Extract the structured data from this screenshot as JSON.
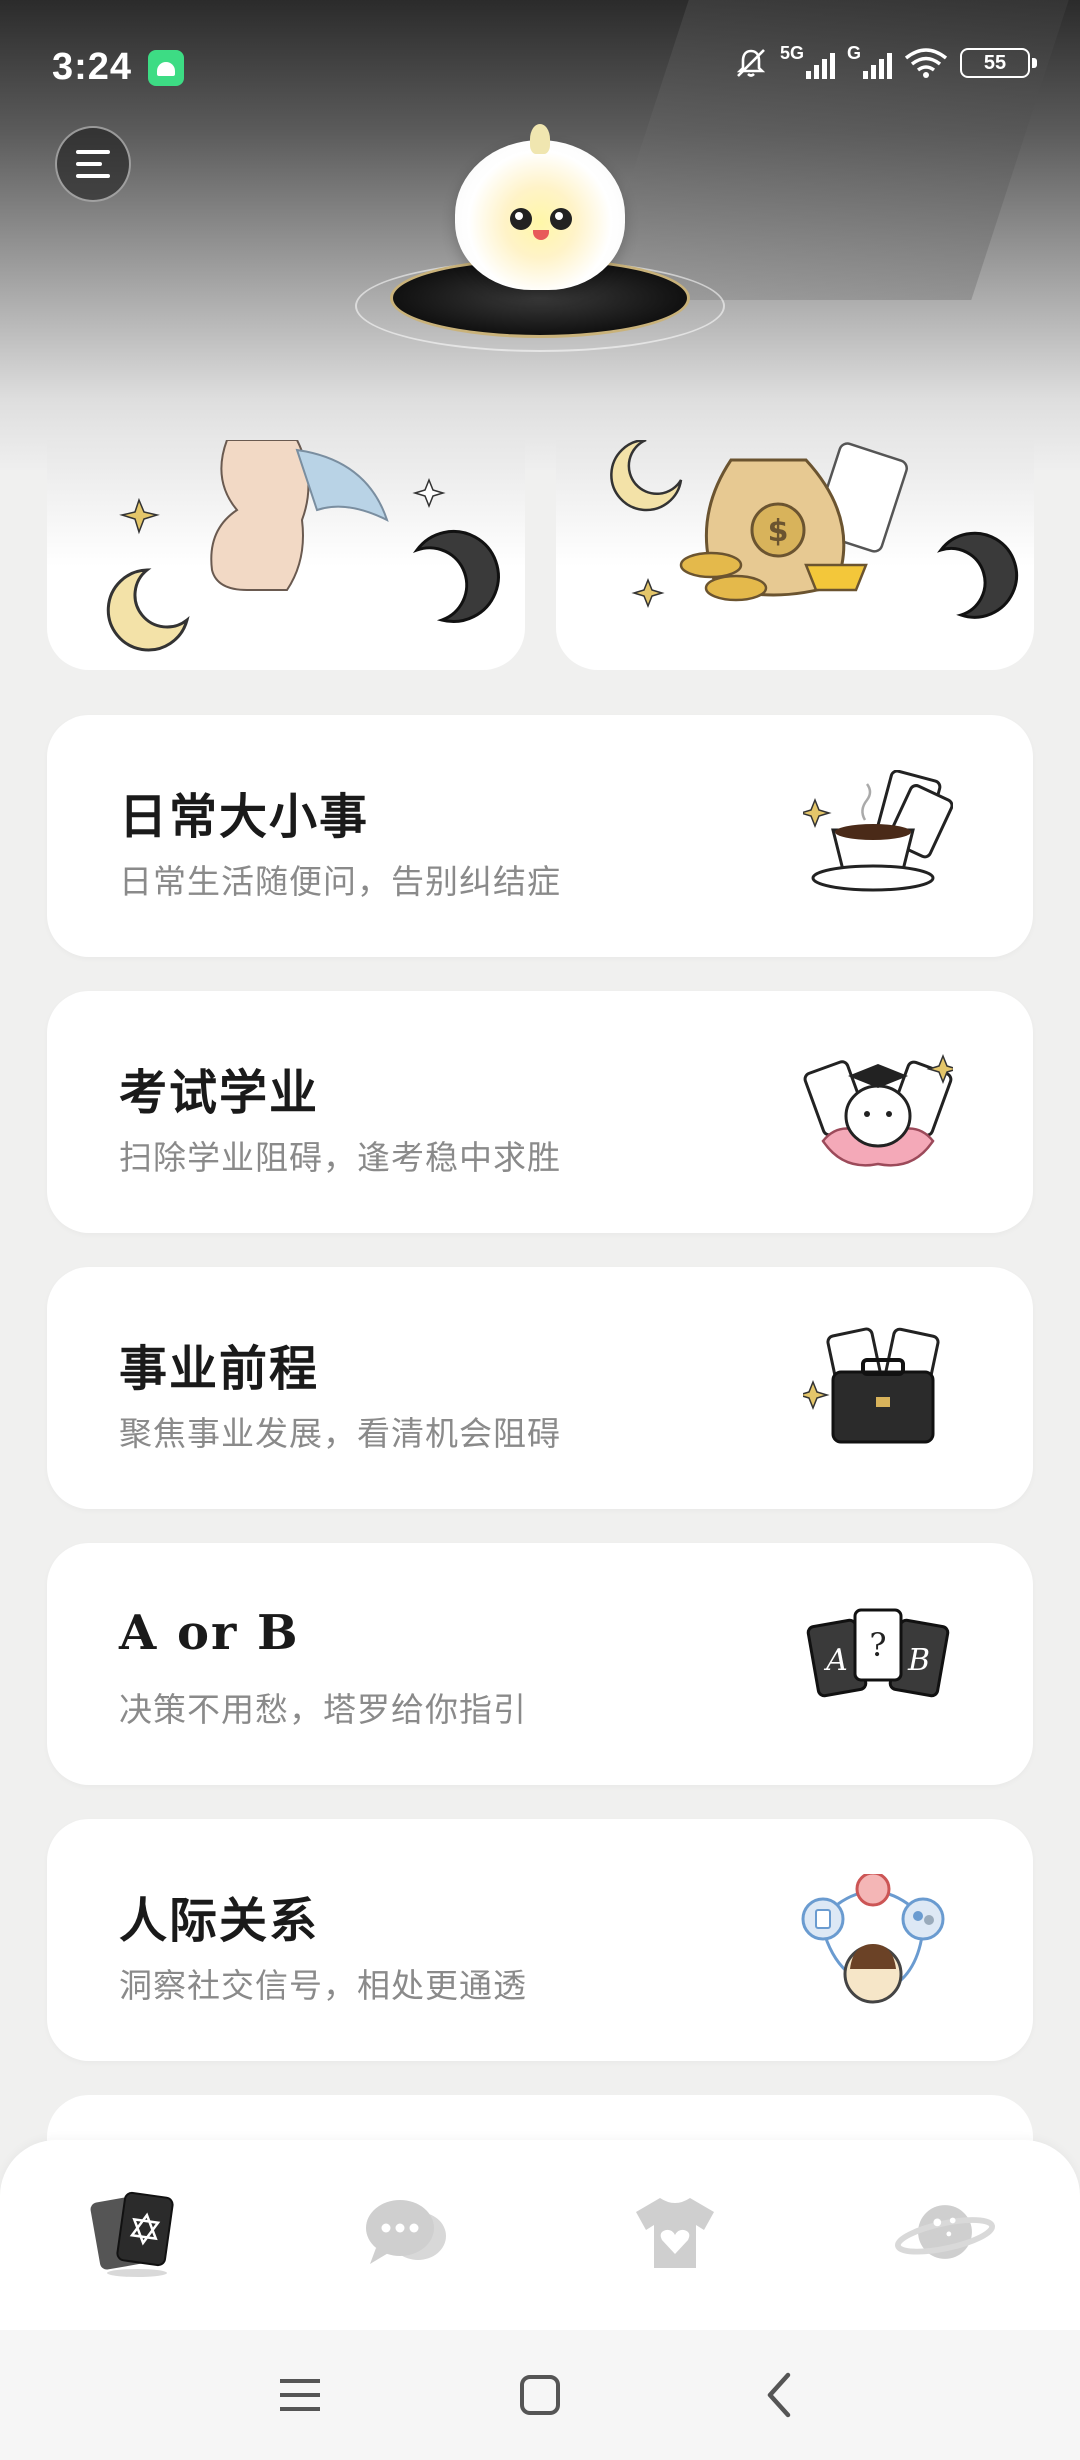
{
  "status_bar": {
    "time": "3:24",
    "network_1": "5G",
    "network_2": "G",
    "battery": "55",
    "icons": [
      "android-notification-icon",
      "mute-bell-icon",
      "signal-icon",
      "wifi-icon",
      "battery-icon"
    ]
  },
  "header": {
    "menu_icon": "hamburger-menu-icon",
    "mascot": "fluffy-mascot-on-tarot-platform"
  },
  "top_cards": [
    {
      "illustration": "angel-wings-moon-stars"
    },
    {
      "illustration": "money-bag-gold-coins-moon"
    }
  ],
  "categories": [
    {
      "title": "日常大小事",
      "subtitle": "日常生活随便问，告别纠结症",
      "icon": "coffee-cup-cards-icon"
    },
    {
      "title": "考试学业",
      "subtitle": "扫除学业阻碍，逢考稳中求胜",
      "icon": "graduate-cat-lotus-icon"
    },
    {
      "title": "事业前程",
      "subtitle": "聚焦事业发展，看清机会阻碍",
      "icon": "briefcase-cards-icon"
    },
    {
      "title": "A or B",
      "subtitle": "决策不用愁，塔罗给你指引",
      "icon": "a-question-b-cards-icon"
    },
    {
      "title": "人际关系",
      "subtitle": "洞察社交信号，相处更通透",
      "icon": "social-circle-icon"
    }
  ],
  "tabs": [
    {
      "name": "tarot",
      "icon": "tarot-cards-icon",
      "active": true
    },
    {
      "name": "chat",
      "icon": "chat-bubble-icon",
      "active": false
    },
    {
      "name": "wardrobe",
      "icon": "tshirt-heart-icon",
      "active": false
    },
    {
      "name": "planet",
      "icon": "planet-icon",
      "active": false
    }
  ],
  "system_nav": [
    "menu-icon",
    "home-square-icon",
    "back-chevron-icon"
  ],
  "colors": {
    "accent_dark": "#1a1a1a",
    "subtitle": "#8a8a8a",
    "gold": "#d8b35b",
    "page_bg": "#f0f0ef"
  }
}
